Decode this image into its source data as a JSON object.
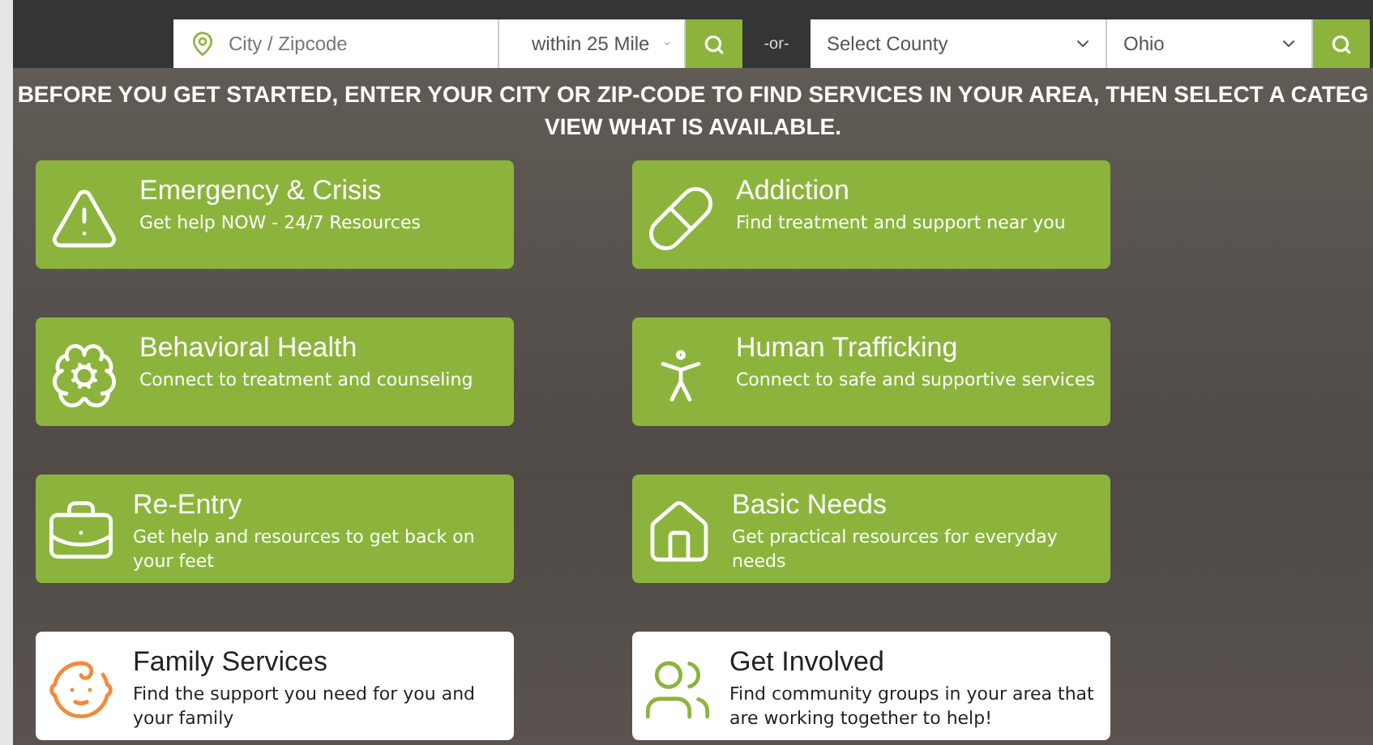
{
  "search": {
    "location_placeholder": "City / Zipcode",
    "distance": "within 25 Mile",
    "separator": "-or-",
    "county": "Select County",
    "state": "Ohio"
  },
  "heading_lines": [
    "BEFORE YOU GET STARTED, ENTER YOUR CITY OR ZIP-CODE TO FIND SERVICES IN YOUR AREA, THEN SELECT A CATEG",
    "VIEW WHAT IS AVAILABLE."
  ],
  "categories": [
    {
      "title": "Emergency & Crisis",
      "description": "Get help NOW - 24/7 Resources",
      "kind": "primary",
      "color": "#ffffff"
    },
    {
      "title": "Addiction",
      "description": "Find treatment and support near you",
      "kind": "primary",
      "color": "#ffffff"
    },
    {
      "title": "Behavioral Health",
      "description": "Connect to treatment and counseling",
      "kind": "primary",
      "color": "#ffffff"
    },
    {
      "title": "Human Trafficking",
      "description": "Connect to safe and supportive services",
      "kind": "primary",
      "color": "#ffffff"
    },
    {
      "title": "Re-Entry",
      "description": "Get help and resources to get back on your feet",
      "kind": "primary",
      "color": "#ffffff"
    },
    {
      "title": "Basic Needs",
      "description": "Get practical resources for everyday needs",
      "kind": "primary",
      "color": "#ffffff"
    },
    {
      "title": "Family Services",
      "description": "Find the support you need for you and your family",
      "kind": "secondary",
      "color": "#f28a3c"
    },
    {
      "title": "Get Involved",
      "description": "Find community groups in your area that are working together to help!",
      "kind": "secondary",
      "color": "#8cb43c"
    }
  ]
}
